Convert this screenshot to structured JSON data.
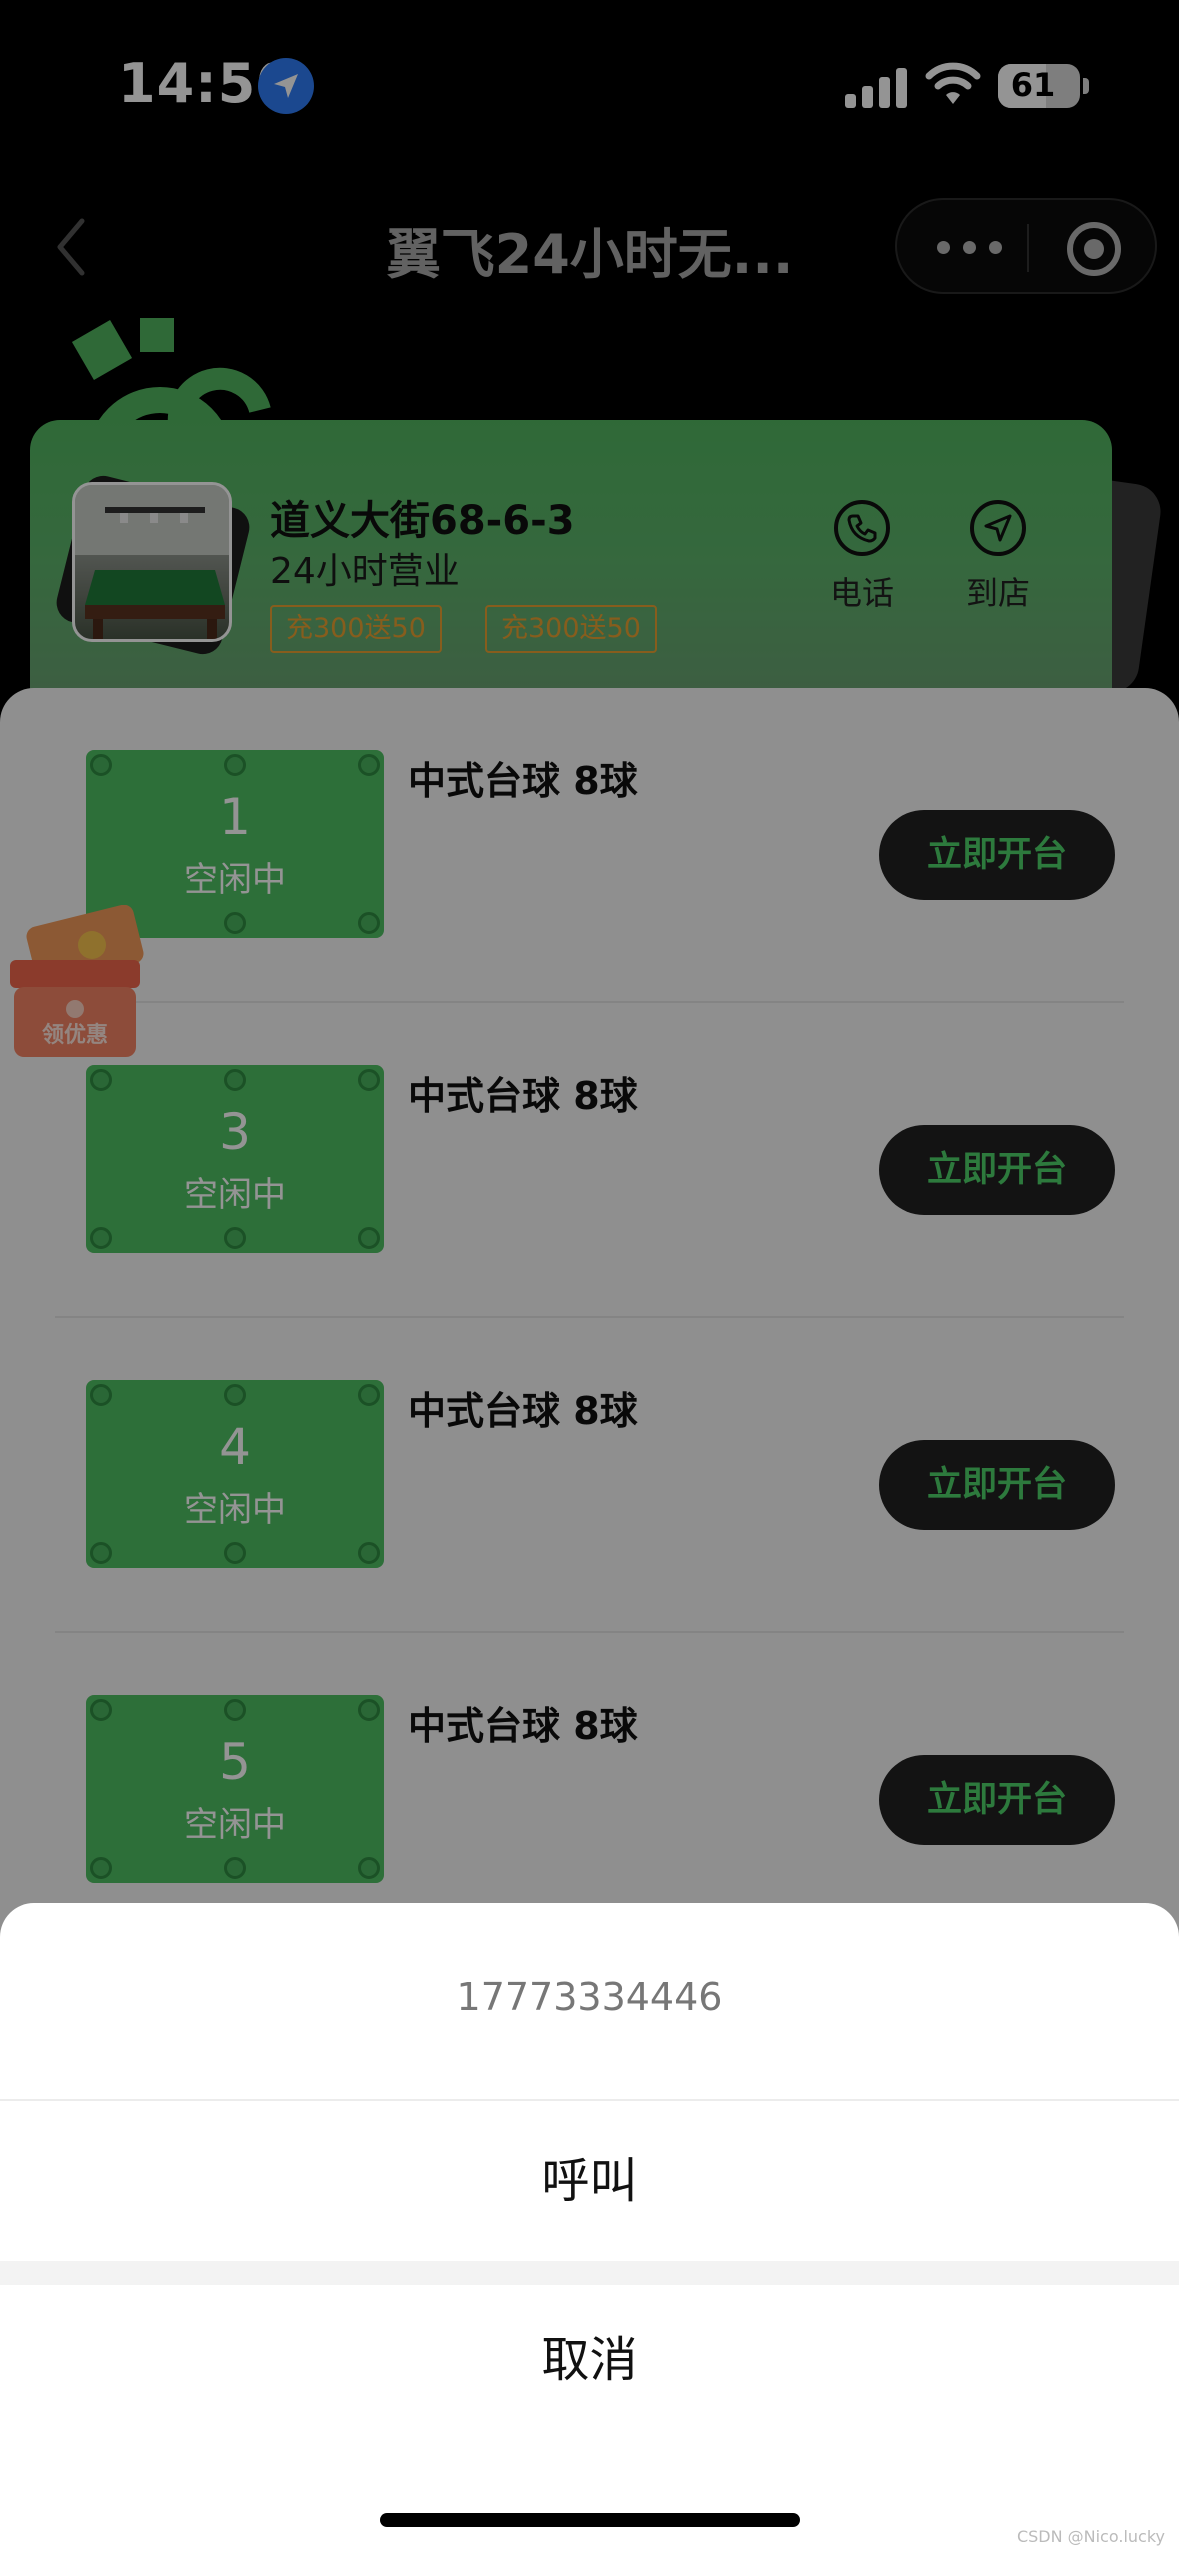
{
  "status_bar": {
    "time": "14:50",
    "battery_level": "61",
    "icons": [
      "location-arrow-icon",
      "signal-icon",
      "wifi-icon",
      "battery-icon"
    ]
  },
  "nav": {
    "title": "翼飞24小时无...",
    "icons": [
      "back-chevron-icon",
      "more-dots-icon",
      "target-circle-icon"
    ]
  },
  "shop": {
    "address": "道义大街68-6-3",
    "hours": "24小时营业",
    "promos": [
      "充300送50",
      "充300送50"
    ],
    "actions": [
      {
        "label": "电话",
        "icon": "phone-icon"
      },
      {
        "label": "到店",
        "icon": "navigate-icon"
      }
    ]
  },
  "tables": [
    {
      "number": "1",
      "status": "空闲中",
      "type": "中式台球 8球",
      "button": "立即开台"
    },
    {
      "number": "3",
      "status": "空闲中",
      "type": "中式台球 8球",
      "button": "立即开台"
    },
    {
      "number": "4",
      "status": "空闲中",
      "type": "中式台球 8球",
      "button": "立即开台"
    },
    {
      "number": "5",
      "status": "空闲中",
      "type": "中式台球 8球",
      "button": "立即开台"
    }
  ],
  "coupon": {
    "label": "领优惠"
  },
  "action_sheet": {
    "phone_number": "17773334446",
    "call_label": "呼叫",
    "cancel_label": "取消"
  },
  "watermark": "CSDN @Nico.lucky",
  "colors": {
    "accent_green": "#4fbf63",
    "button_text_green": "#4fd26a",
    "promo_orange": "#e8a132",
    "location_blue": "#2f7cf6"
  }
}
